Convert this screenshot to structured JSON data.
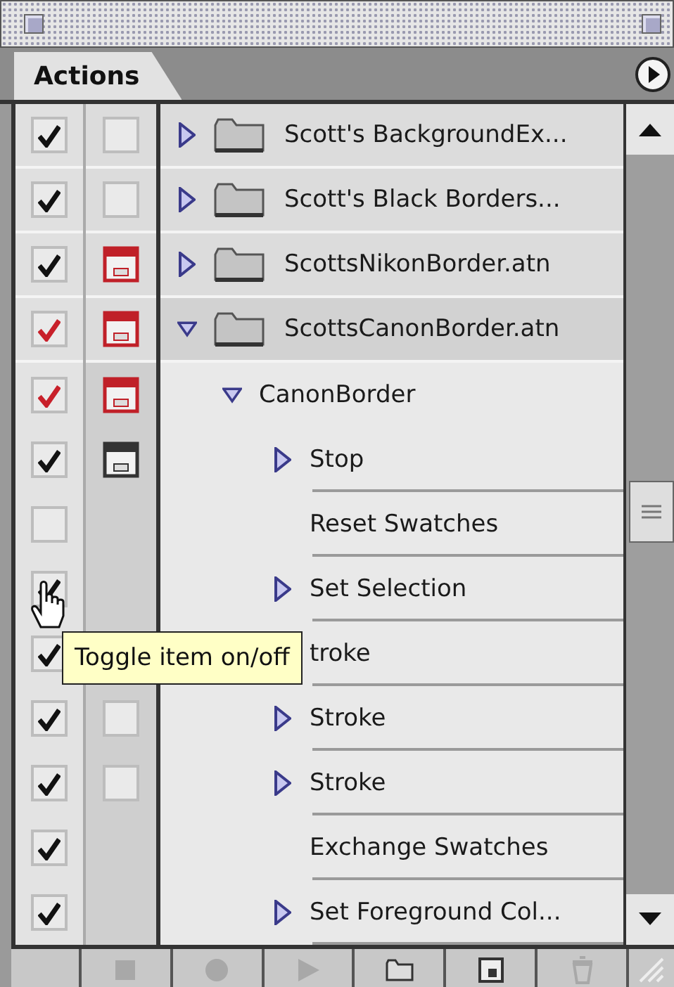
{
  "tabs": [
    {
      "label": "Actions",
      "selected": true
    }
  ],
  "actions": [
    {
      "kind": "set",
      "name": "Scott's BackgroundEx...",
      "checked": true,
      "check_partial": false,
      "dialog_on": false,
      "expanded": false
    },
    {
      "kind": "set",
      "name": "Scott's Black Borders...",
      "checked": true,
      "check_partial": false,
      "dialog_on": false,
      "expanded": false
    },
    {
      "kind": "set",
      "name": "ScottsNikonBorder.atn",
      "checked": true,
      "check_partial": false,
      "dialog_on": true,
      "dialog_partial": true,
      "expanded": false
    },
    {
      "kind": "set",
      "name": "ScottsCanonBorder.atn",
      "checked": true,
      "check_partial": true,
      "dialog_on": true,
      "dialog_partial": true,
      "expanded": true,
      "children": [
        {
          "kind": "action",
          "name": "CanonBorder",
          "checked": true,
          "check_partial": true,
          "dialog_on": true,
          "dialog_partial": true,
          "expanded": true,
          "children": [
            {
              "kind": "command",
              "name": "Stop",
              "checked": true,
              "check_partial": false,
              "dialog_on": true,
              "dialog_partial": false,
              "expanded": false
            },
            {
              "kind": "command",
              "name": "Reset Swatches",
              "checked": false
            },
            {
              "kind": "command",
              "name": "Set Selection",
              "checked": true,
              "check_partial": false,
              "expanded": false
            },
            {
              "kind": "command",
              "name": "troke",
              "checked": true,
              "check_partial": false
            },
            {
              "kind": "command",
              "name": "Stroke",
              "checked": true,
              "check_partial": false,
              "dialog_on": false,
              "expanded": false
            },
            {
              "kind": "command",
              "name": "Stroke",
              "checked": true,
              "check_partial": false,
              "dialog_on": false,
              "expanded": false
            },
            {
              "kind": "command",
              "name": "Exchange Swatches",
              "checked": true,
              "check_partial": false
            },
            {
              "kind": "command",
              "name": "Set Foreground Col...",
              "checked": true,
              "check_partial": false,
              "expanded": false
            }
          ]
        }
      ]
    }
  ],
  "tooltip": {
    "text": "Toggle item on/off"
  },
  "toolbar": [
    {
      "kind": "stop",
      "disabled": true
    },
    {
      "kind": "record",
      "disabled": true
    },
    {
      "kind": "play",
      "disabled": true
    },
    {
      "kind": "new-set",
      "disabled": false
    },
    {
      "kind": "new-action",
      "disabled": false
    },
    {
      "kind": "delete",
      "disabled": true
    }
  ]
}
